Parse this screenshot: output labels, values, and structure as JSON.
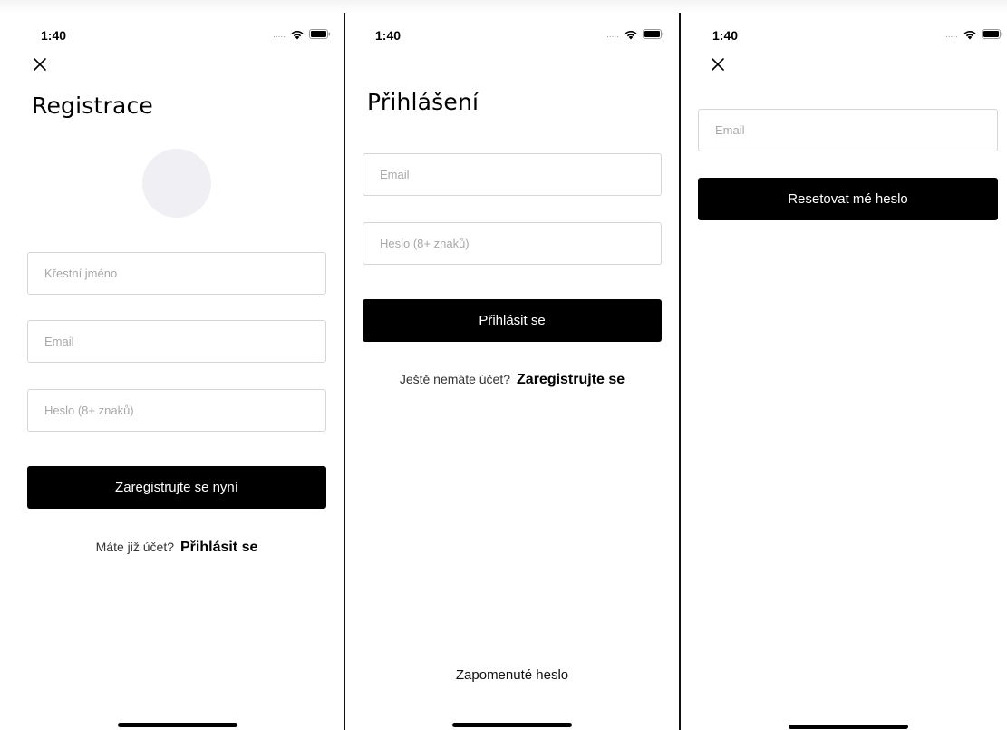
{
  "status_bar": {
    "time": "1:40",
    "signal": "....."
  },
  "register": {
    "title": "Registrace",
    "first_name_placeholder": "Křestní jméno",
    "email_placeholder": "Email",
    "password_placeholder": "Heslo (8+ znaků)",
    "submit_label": "Zaregistrujte se nyní",
    "prompt_text": "Máte již účet?",
    "prompt_link": "Přihlásit se"
  },
  "login": {
    "title": "Přihlášení",
    "email_placeholder": "Email",
    "password_placeholder": "Heslo (8+ znaků)",
    "submit_label": "Přihlásit se",
    "prompt_text": "Ještě nemáte účet?",
    "prompt_link": "Zaregistrujte se",
    "forgot_label": "Zapomenuté heslo"
  },
  "reset": {
    "email_placeholder": "Email",
    "submit_label": "Resetovat mé heslo"
  },
  "icons": {
    "close": "close-icon",
    "wifi": "wifi-icon",
    "battery": "battery-icon"
  },
  "colors": {
    "button_bg": "#000000",
    "button_text": "#ffffff",
    "avatar_bg": "#efeff4",
    "field_border": "#d6d6d6",
    "placeholder": "#a8a8a8"
  }
}
